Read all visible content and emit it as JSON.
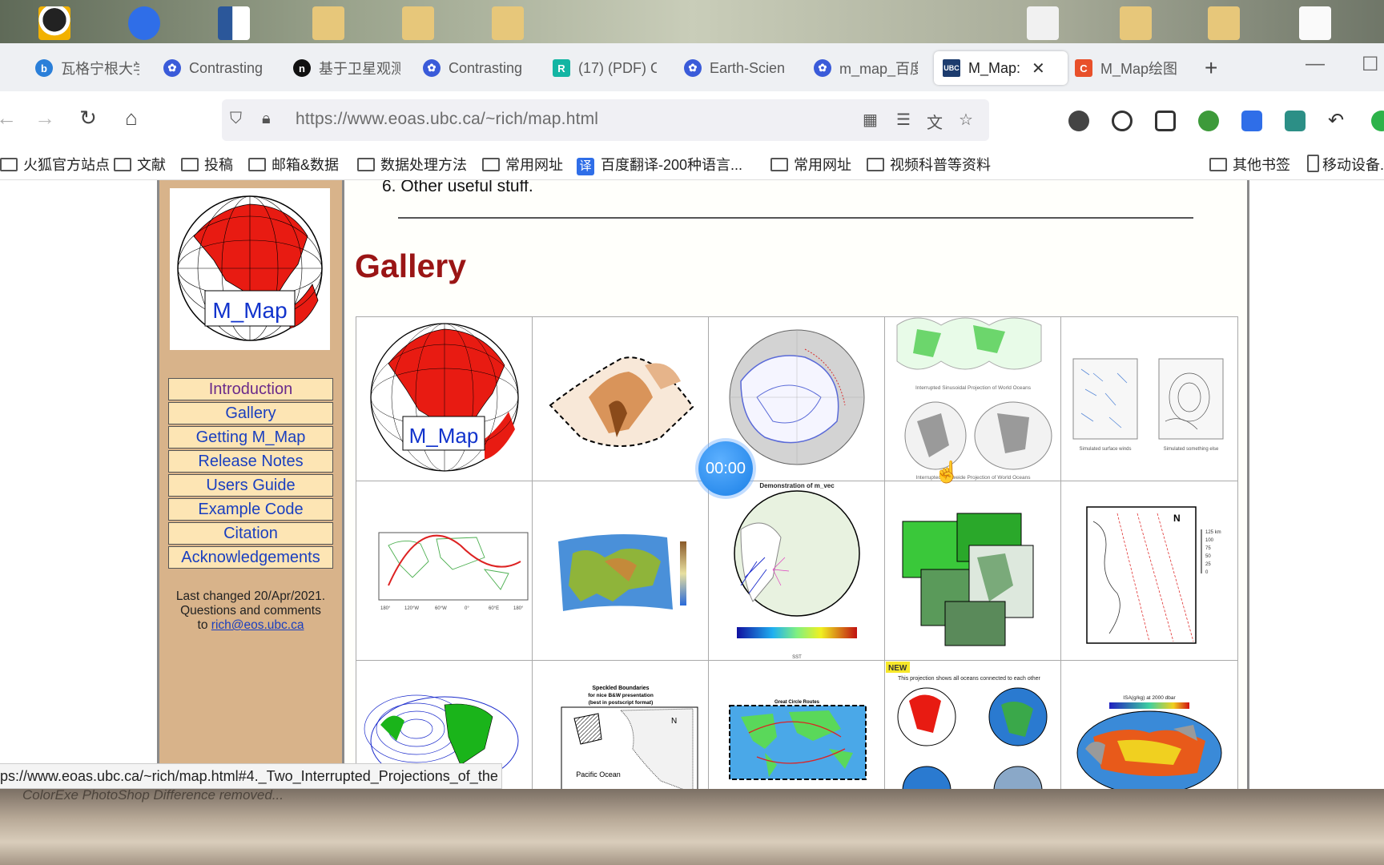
{
  "desktop": {
    "bottom_text": "ColorExe  PhotoShop  Difference  removed..."
  },
  "tabs": [
    {
      "label": "瓦格宁根大学",
      "icon": "bing-icon",
      "color": "#2a7fd9"
    },
    {
      "label": "Contrasting",
      "icon": "baidu-paw-icon",
      "color": "#3a5bd9"
    },
    {
      "label": "基于卫星观测",
      "icon": "n-logo-icon",
      "color": "#111111"
    },
    {
      "label": "Contrasting",
      "icon": "baidu-paw-icon",
      "color": "#3a5bd9"
    },
    {
      "label": "(17) (PDF) C",
      "icon": "researchgate-icon",
      "color": "#13b5a3"
    },
    {
      "label": "Earth-Scien",
      "icon": "baidu-paw-icon",
      "color": "#3a5bd9"
    },
    {
      "label": "m_map_百度",
      "icon": "baidu-paw-icon",
      "color": "#3a5bd9"
    },
    {
      "label": "M_Map:",
      "icon": "ubc-eoas-icon",
      "color": "#1d3c6e",
      "active": true
    },
    {
      "label": "M_Map绘图",
      "icon": "c-logo-icon",
      "color": "#e8502a"
    }
  ],
  "tab_new": "+",
  "window": {
    "minimize": "—",
    "maximize": "☐"
  },
  "address": {
    "url": "https://www.eoas.ubc.ca/~rich/map.html"
  },
  "bookmarks": [
    "火狐官方站点",
    "文献",
    "投稿",
    "邮箱&数据",
    "数据处理方法",
    "常用网址",
    "百度翻译-200种语言...",
    "常用网址",
    "视频科普等资料"
  ],
  "bookmarks_right": [
    "其他书签",
    "移动设备..."
  ],
  "sidebar": {
    "logo_text": "M_Map",
    "nav": [
      "Introduction",
      "Gallery",
      "Getting M_Map",
      "Release Notes",
      "Users Guide",
      "Example Code",
      "Citation",
      "Acknowledgements"
    ],
    "last_changed": "Last changed 20/Apr/2021.",
    "questions": "Questions and comments",
    "to": "to",
    "email": "rich@eos.ubc.ca"
  },
  "content": {
    "list_item": "6. Other useful stuff.",
    "gallery_title": "Gallery",
    "cells": {
      "c4_title": "Interrupted Sinusoidal Projection of World Oceans",
      "c4_sub": "Interrupted Mollweide Projection of World Oceans",
      "c5_left": "Simulated surface winds",
      "c5_right": "Simulated something else",
      "c8_title": "Demonstration of m_vec",
      "c8_sst": "SST",
      "c12_title": "Speckled Boundaries",
      "c12_sub1": "for nice B&W presentation",
      "c12_sub2": "(best in postscript format)",
      "c12_ocean": "Pacific Ocean",
      "c13_title": "Great Circle Routes",
      "c14_badge": "NEW",
      "c14_caption": "This projection shows all oceans connected to each other",
      "c15_title": "ISA(g/kg) at 2000 dbar",
      "c10_scale": "125 km"
    }
  },
  "timer": "00:00",
  "status_url": "ps://www.eoas.ubc.ca/~rich/map.html#4._Two_Interrupted_Projections_of_the"
}
